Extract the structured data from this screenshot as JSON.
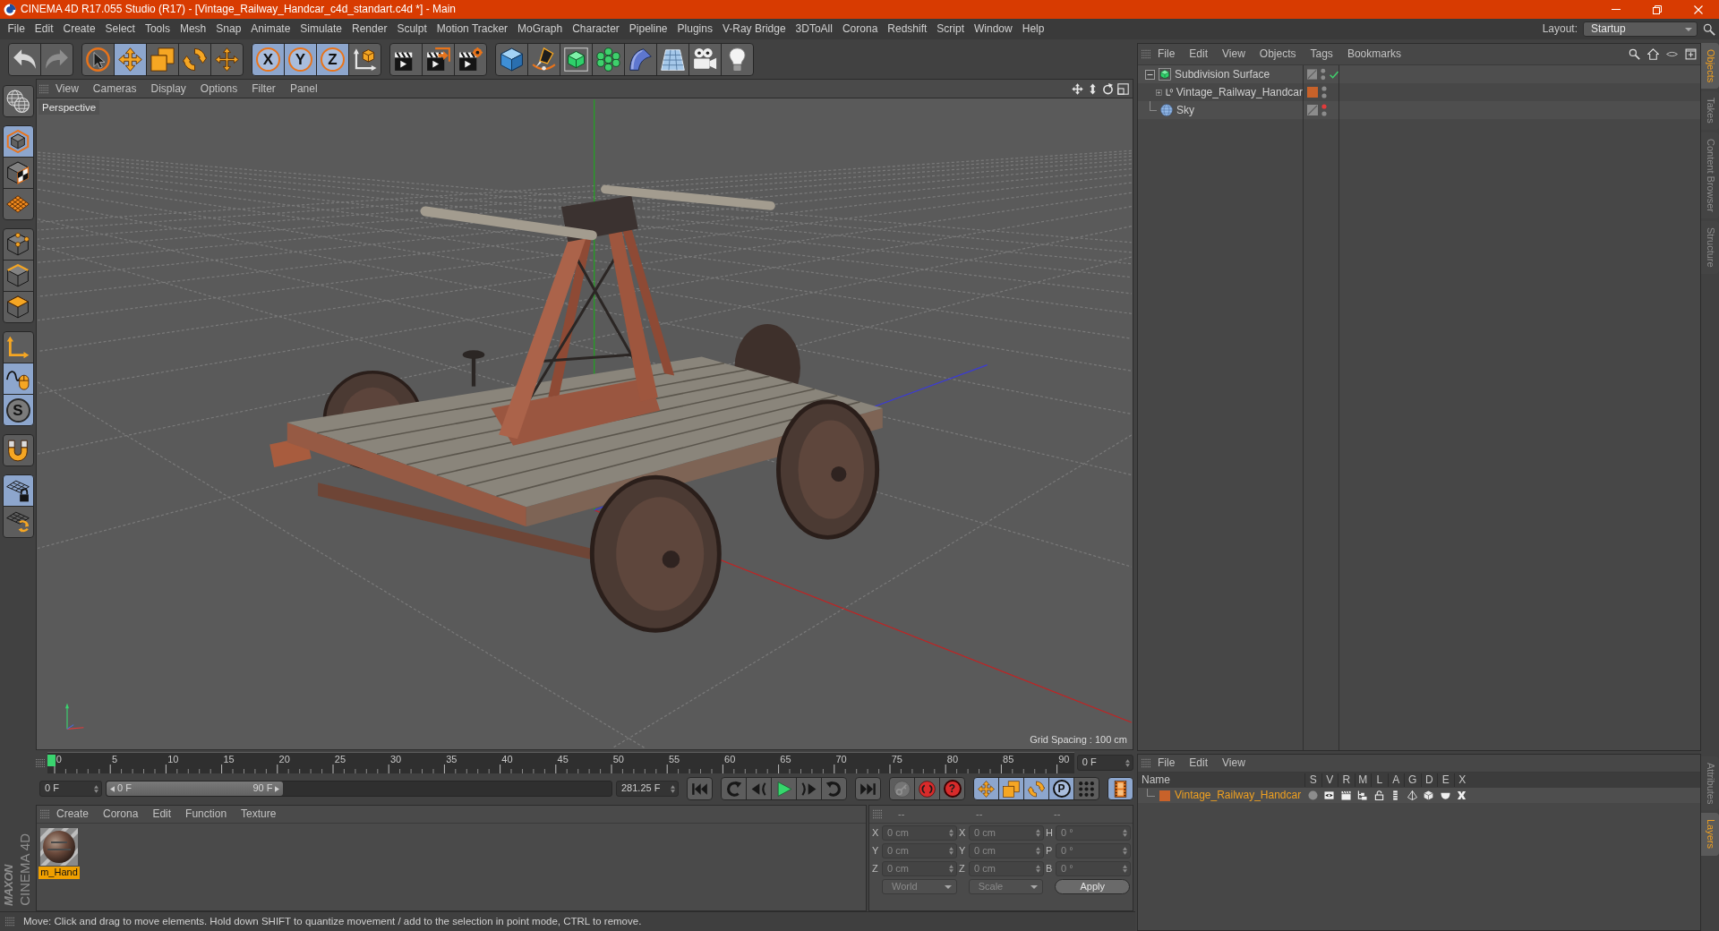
{
  "window": {
    "title": "CINEMA 4D R17.055 Studio (R17) - [Vintage_Railway_Handcar_c4d_standart.c4d *] - Main"
  },
  "menu_bar": {
    "items": [
      "File",
      "Edit",
      "Create",
      "Select",
      "Tools",
      "Mesh",
      "Snap",
      "Animate",
      "Simulate",
      "Render",
      "Sculpt",
      "Motion Tracker",
      "MoGraph",
      "Character",
      "Pipeline",
      "Plugins",
      "V-Ray Bridge",
      "3DToAll",
      "Corona",
      "Redshift",
      "Script",
      "Window",
      "Help"
    ],
    "layout_label": "Layout:",
    "layout_value": "Startup"
  },
  "toolbar": {
    "groups": [
      [
        {
          "kind": "undo",
          "selected": false,
          "disabled": false
        },
        {
          "kind": "redo",
          "selected": false,
          "disabled": true
        }
      ],
      [
        {
          "kind": "select",
          "selected": false,
          "disabled": false
        },
        {
          "kind": "move",
          "selected": true,
          "disabled": false
        },
        {
          "kind": "scale",
          "selected": false,
          "disabled": false
        },
        {
          "kind": "rotate",
          "selected": false,
          "disabled": false
        },
        {
          "kind": "transform",
          "selected": false,
          "disabled": false
        }
      ],
      [
        {
          "kind": "axislock",
          "label": "X",
          "selected": true,
          "disabled": false
        },
        {
          "kind": "axislock",
          "label": "Y",
          "selected": true,
          "disabled": false
        },
        {
          "kind": "axislock",
          "label": "Z",
          "selected": true,
          "disabled": false
        },
        {
          "kind": "coords",
          "selected": false,
          "disabled": false
        }
      ],
      [
        {
          "kind": "renderview",
          "selected": false,
          "disabled": false
        },
        {
          "kind": "renderpicture",
          "selected": false,
          "disabled": false
        },
        {
          "kind": "rendersettings",
          "selected": false,
          "disabled": false
        }
      ],
      [
        {
          "kind": "cube",
          "selected": false,
          "disabled": false
        },
        {
          "kind": "pen",
          "selected": false,
          "disabled": false
        },
        {
          "kind": "subdivision",
          "selected": false,
          "disabled": false
        },
        {
          "kind": "cloner",
          "selected": false,
          "disabled": false
        },
        {
          "kind": "bend",
          "selected": false,
          "disabled": false
        },
        {
          "kind": "floor",
          "selected": false,
          "disabled": false
        },
        {
          "kind": "camera",
          "selected": false,
          "disabled": false
        },
        {
          "kind": "light",
          "selected": false,
          "disabled": false
        }
      ]
    ]
  },
  "left_toolbar": {
    "groups": [
      [
        {
          "kind": "editable",
          "selected": false
        }
      ],
      [
        {
          "kind": "model",
          "selected": true
        },
        {
          "kind": "texture",
          "selected": false
        },
        {
          "kind": "workplane",
          "selected": false
        }
      ],
      [
        {
          "kind": "points",
          "selected": false
        },
        {
          "kind": "edges",
          "selected": false
        },
        {
          "kind": "polygons",
          "selected": false
        }
      ],
      [
        {
          "kind": "axis",
          "selected": false
        },
        {
          "kind": "tweak",
          "selected": true
        },
        {
          "kind": "solo",
          "label": "S",
          "selected": true
        }
      ],
      [
        {
          "kind": "snap",
          "selected": false
        }
      ],
      [
        {
          "kind": "planelock",
          "selected": true
        },
        {
          "kind": "planerotate",
          "selected": false
        }
      ]
    ]
  },
  "branding": {
    "maker": "MAXON",
    "product": "CINEMA 4D"
  },
  "viewport": {
    "menu": [
      "View",
      "Cameras",
      "Display",
      "Options",
      "Filter",
      "Panel"
    ],
    "camera": "Perspective",
    "grid_spacing": "Grid Spacing : 100 cm"
  },
  "timeline": {
    "ticks": [
      "0",
      "5",
      "10",
      "15",
      "20",
      "25",
      "30",
      "35",
      "40",
      "45",
      "50",
      "55",
      "60",
      "65",
      "70",
      "75",
      "80",
      "85",
      "90"
    ],
    "level": 0,
    "frame_field": "0 F"
  },
  "time_controls": {
    "start_field": "0 F",
    "range": {
      "start": "0 F",
      "end": "90 F",
      "level": 0.35
    },
    "end_field": "281.25 F",
    "groups": [
      [
        {
          "kind": "first",
          "selected": false,
          "disabled": false
        }
      ],
      [
        {
          "kind": "prevkey",
          "selected": false,
          "disabled": false
        },
        {
          "kind": "prevframe",
          "selected": false,
          "disabled": false
        },
        {
          "kind": "play",
          "selected": false,
          "disabled": false
        },
        {
          "kind": "nextframe",
          "selected": false,
          "disabled": false
        },
        {
          "kind": "nextkey",
          "selected": false,
          "disabled": false
        }
      ],
      [
        {
          "kind": "last",
          "selected": false,
          "disabled": false
        }
      ],
      [
        {
          "kind": "keys",
          "selected": false,
          "disabled": true
        },
        {
          "kind": "record",
          "selected": false,
          "disabled": false
        },
        {
          "kind": "autokey",
          "label": "?",
          "selected": false,
          "disabled": false
        }
      ],
      [
        {
          "kind": "keymove",
          "selected": true,
          "disabled": false
        },
        {
          "kind": "keyscale",
          "selected": true,
          "disabled": false
        },
        {
          "kind": "keyrotate",
          "selected": true,
          "disabled": false
        },
        {
          "kind": "param",
          "label": "P",
          "selected": true,
          "disabled": false
        },
        {
          "kind": "pla",
          "selected": false,
          "disabled": false
        }
      ],
      [
        {
          "kind": "timeline",
          "selected": true,
          "disabled": false
        }
      ]
    ]
  },
  "material_manager": {
    "menu": [
      "Create",
      "Corona",
      "Edit",
      "Function",
      "Texture"
    ],
    "materials": [
      {
        "name": "m_Hand",
        "selected": true
      }
    ]
  },
  "coordinates": {
    "groups": [
      {
        "header": "--",
        "fields": [
          {
            "axis": "X",
            "value": "0 cm"
          },
          {
            "axis": "Y",
            "value": "0 cm"
          },
          {
            "axis": "Z",
            "value": "0 cm"
          }
        ]
      },
      {
        "header": "--",
        "fields": [
          {
            "axis": "X",
            "value": "0 cm"
          },
          {
            "axis": "Y",
            "value": "0 cm"
          },
          {
            "axis": "Z",
            "value": "0 cm"
          }
        ]
      },
      {
        "header": "--",
        "fields": [
          {
            "axis": "H",
            "value": "0 °"
          },
          {
            "axis": "P",
            "value": "0 °"
          },
          {
            "axis": "B",
            "value": "0 °"
          }
        ]
      }
    ],
    "modes": [
      "World",
      "Scale"
    ],
    "apply": "Apply"
  },
  "status_bar": {
    "text": "Move: Click and drag to move elements. Hold down SHIFT to quantize movement / add to the selection in point mode, CTRL to remove."
  },
  "object_manager": {
    "menu": [
      "File",
      "Edit",
      "View",
      "Objects",
      "Tags",
      "Bookmarks"
    ],
    "objects": [
      {
        "name": "Subdivision Surface",
        "kind": "generator",
        "expanded": true,
        "editor_visible": true,
        "enabled": true,
        "children": [
          {
            "name": "Vintage_Railway_Handcar",
            "kind": "null",
            "expanded": false,
            "editor_visible": true,
            "enabled": false,
            "color": "#c8622a"
          }
        ]
      },
      {
        "name": "Sky",
        "kind": "sky",
        "editor_visible": false,
        "enabled": false
      }
    ]
  },
  "layer_manager": {
    "menu": [
      "File",
      "Edit",
      "View"
    ],
    "columns": [
      {
        "label": "Name",
        "kind": "name"
      },
      {
        "label": "S",
        "kind": "solo"
      },
      {
        "label": "V",
        "kind": "view"
      },
      {
        "label": "R",
        "kind": "render"
      },
      {
        "label": "M",
        "kind": "manager"
      },
      {
        "label": "L",
        "kind": "lock"
      },
      {
        "label": "A",
        "kind": "animation"
      },
      {
        "label": "G",
        "kind": "generators"
      },
      {
        "label": "D",
        "kind": "deformers"
      },
      {
        "label": "E",
        "kind": "expressions"
      },
      {
        "label": "X",
        "kind": "xrefs"
      }
    ],
    "layers": [
      {
        "name": "Vintage_Railway_Handcar",
        "color": "#c8622a",
        "selected": true
      }
    ]
  },
  "side_tabs": {
    "top": [
      {
        "label": "Objects",
        "selected": true
      },
      {
        "label": "Takes",
        "selected": false
      },
      {
        "label": "Content Browser",
        "selected": false
      },
      {
        "label": "Structure",
        "selected": false
      }
    ],
    "bottom": [
      {
        "label": "Attributes",
        "selected": false
      },
      {
        "label": "Layers",
        "selected": true
      }
    ]
  }
}
